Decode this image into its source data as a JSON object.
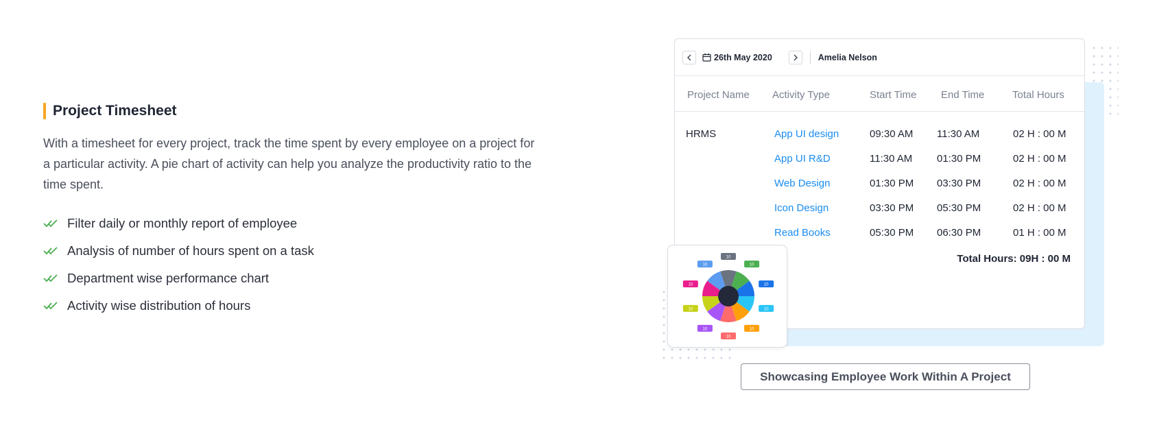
{
  "feature": {
    "title": "Project Timesheet",
    "description": "With a timesheet for every project, track the time spent by every employee on a project for a particular activity. A pie chart of activity can help you analyze the productivity ratio to the time spent.",
    "bullets": [
      "Filter daily or monthly report of employee",
      "Analysis of number of hours spent on a task",
      "Department wise performance chart",
      "Activity wise distribution of hours"
    ],
    "accent_color": "#f5a623",
    "check_color": "#4caf50"
  },
  "timesheet": {
    "prev_icon": "chevron-left-icon",
    "next_icon": "chevron-right-icon",
    "date": "26th May 2020",
    "employee": "Amelia Nelson",
    "headers": [
      "Project Name",
      "Activity Type",
      "Start Time",
      "End Time",
      "Total Hours"
    ],
    "project": "HRMS",
    "rows": [
      {
        "activity": "App UI design",
        "start": "09:30 AM",
        "end": "11:30 AM",
        "hours": "02 H : 00 M"
      },
      {
        "activity": "App UI R&D",
        "start": "11:30 AM",
        "end": "01:30 PM",
        "hours": "02 H : 00 M"
      },
      {
        "activity": "Web Design",
        "start": "01:30 PM",
        "end": "03:30 PM",
        "hours": "02 H : 00 M"
      },
      {
        "activity": "Icon Design",
        "start": "03:30 PM",
        "end": "05:30 PM",
        "hours": "02 H : 00 M"
      },
      {
        "activity": "Read Books",
        "start": "05:30 PM",
        "end": "06:30 PM",
        "hours": "01 H : 00 M"
      }
    ],
    "total": "Total Hours: 09H : 00 M",
    "link_color": "#1a8cf0"
  },
  "pie": {
    "slice_label": "10",
    "colors": [
      "#6b7280",
      "#4caf50",
      "#1a73e8",
      "#29c5f6",
      "#ff9f0a",
      "#ff6b6b",
      "#a855f7",
      "#c7d21a",
      "#e91e8c",
      "#5b9cf0"
    ]
  },
  "caption": "Showcasing Employee Work Within A Project"
}
